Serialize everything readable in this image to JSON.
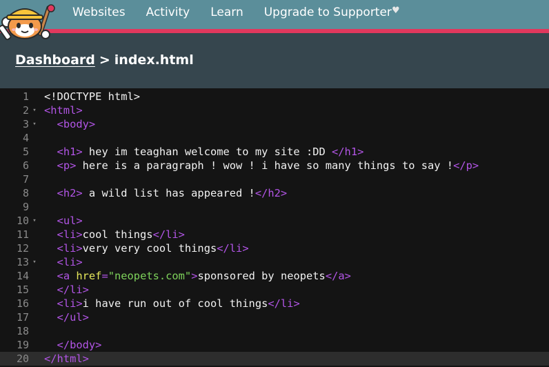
{
  "nav": {
    "items": [
      "Websites",
      "Activity",
      "Learn",
      "Upgrade to Supporter"
    ],
    "heart_icon": "heart-icon"
  },
  "breadcrumb": {
    "root": "Dashboard",
    "separator": ">",
    "current": "index.html"
  },
  "colors": {
    "topbar": "#5b8e9a",
    "accent": "#e1385d",
    "header": "#36464e",
    "editor_bg": "#141414",
    "tag": "#b255e6",
    "attribute": "#e6e85b",
    "string": "#7ed35b"
  },
  "editor": {
    "lines": [
      {
        "num": "1",
        "fold": false,
        "code": "<!DOCTYPE html>"
      },
      {
        "num": "2",
        "fold": true,
        "code": "<html>"
      },
      {
        "num": "3",
        "fold": true,
        "code": "  <body>"
      },
      {
        "num": "4",
        "fold": false,
        "code": ""
      },
      {
        "num": "5",
        "fold": false,
        "code": "  <h1> hey im teaghan welcome to my site :DD </h1>"
      },
      {
        "num": "6",
        "fold": false,
        "code": "  <p> here is a paragraph ! wow ! i have so many things to say !</p>"
      },
      {
        "num": "7",
        "fold": false,
        "code": ""
      },
      {
        "num": "8",
        "fold": false,
        "code": "  <h2> a wild list has appeared !</h2>"
      },
      {
        "num": "9",
        "fold": false,
        "code": ""
      },
      {
        "num": "10",
        "fold": true,
        "code": "  <ul>"
      },
      {
        "num": "11",
        "fold": false,
        "code": "  <li>cool things</li>"
      },
      {
        "num": "12",
        "fold": false,
        "code": "  <li>very very cool things</li>"
      },
      {
        "num": "13",
        "fold": true,
        "code": "  <li>"
      },
      {
        "num": "14",
        "fold": false,
        "code": "  <a href=\"neopets.com\">sponsored by neopets</a>"
      },
      {
        "num": "15",
        "fold": false,
        "code": "  </li>"
      },
      {
        "num": "16",
        "fold": false,
        "code": "  <li>i have run out of cool things</li>"
      },
      {
        "num": "17",
        "fold": false,
        "code": "  </ul>"
      },
      {
        "num": "18",
        "fold": false,
        "code": ""
      },
      {
        "num": "19",
        "fold": false,
        "code": "  </body>"
      },
      {
        "num": "20",
        "fold": false,
        "code": "</html>"
      }
    ],
    "active_line": "20"
  }
}
